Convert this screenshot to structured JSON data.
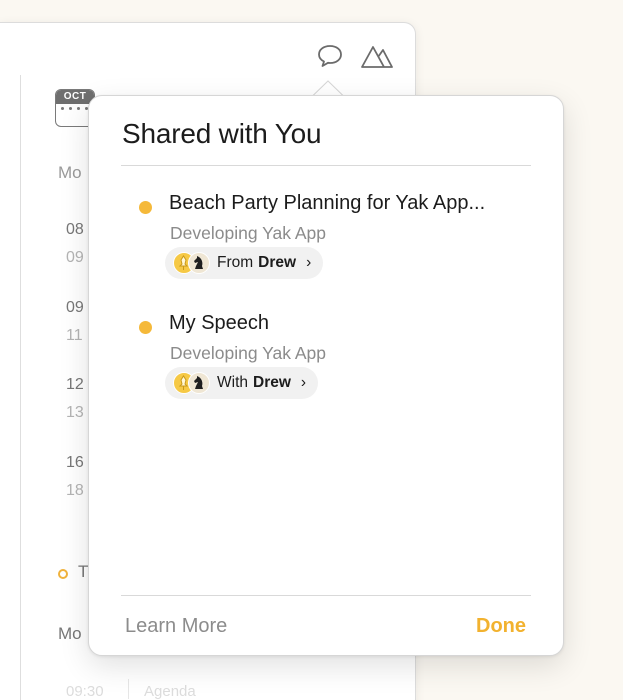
{
  "background": {
    "calendar_month": "OCT",
    "day_label_top": "Mo",
    "times": [
      {
        "main": "08",
        "sub": "09"
      },
      {
        "main": "09",
        "sub": "11"
      },
      {
        "main": "12",
        "sub": "13"
      },
      {
        "main": "16",
        "sub": "18"
      }
    ],
    "task_label": "T",
    "day_label_bottom": "Mo",
    "faded_time": "09:30",
    "faded_title": "Agenda"
  },
  "popover": {
    "title": "Shared with You",
    "items": [
      {
        "title": "Beach Party Planning for Yak App...",
        "subtitle": "Developing Yak App",
        "chip_prefix": "From",
        "chip_name": "Drew",
        "chevron": "›"
      },
      {
        "title": "My Speech",
        "subtitle": "Developing Yak App",
        "chip_prefix": "With",
        "chip_name": "Drew",
        "chevron": "›"
      }
    ],
    "learn_more_label": "Learn More",
    "done_label": "Done"
  },
  "icons": {
    "toolbar": [
      "chat-bubble-icon",
      "mountain-icon"
    ],
    "calendar": "calendar-icon",
    "status_dot": "unread-dot-icon",
    "avatars": [
      "pin-avatar-icon",
      "chess-knight-avatar-icon"
    ]
  },
  "colors": {
    "accent": "#f2b22f",
    "unread_dot": "#f5b93a",
    "chip_background": "#f1f1f1"
  }
}
